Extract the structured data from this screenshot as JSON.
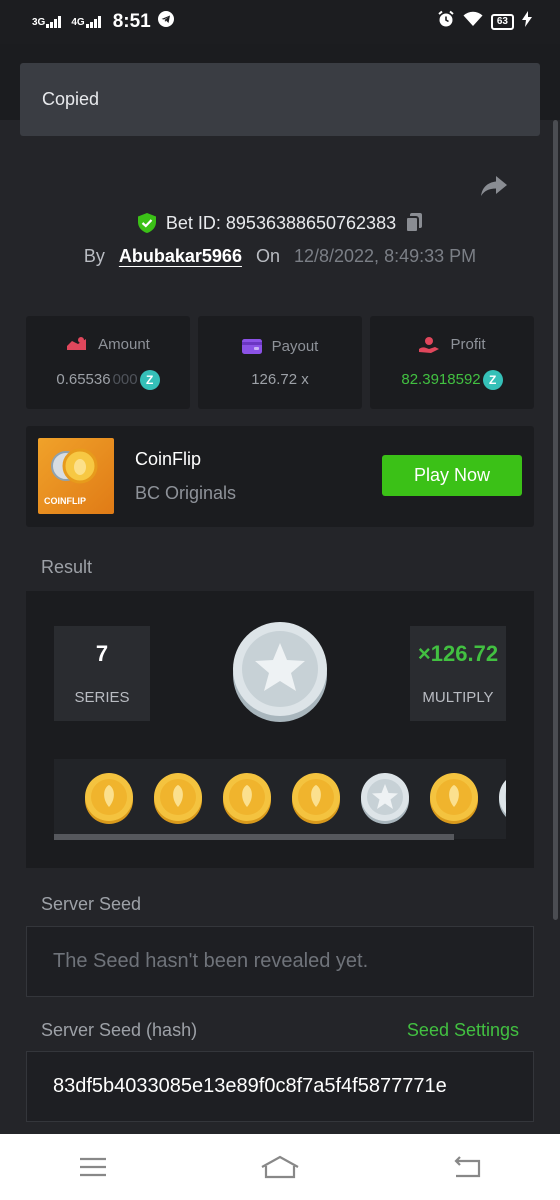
{
  "status_bar": {
    "net1": "3G",
    "net2": "4G",
    "time": "8:51",
    "battery": "63"
  },
  "toast": {
    "text": "Copied"
  },
  "bet": {
    "id_label": "Bet ID: 89536388650762383",
    "by_label": "By",
    "username": "Abubakar5966",
    "on_label": "On",
    "date": "12/8/2022, 8:49:33 PM"
  },
  "stats": {
    "amount_label": "Amount",
    "amount_value": "0.65536",
    "amount_trailing_zeros": "000",
    "payout_label": "Payout",
    "payout_value": "126.72 x",
    "profit_label": "Profit",
    "profit_value": "82.3918592"
  },
  "game": {
    "thumb_text": "COINFLIP",
    "name": "CoinFlip",
    "provider": "BC Originals",
    "play_label": "Play Now"
  },
  "result": {
    "section_label": "Result",
    "series_value": "7",
    "series_label": "SERIES",
    "multiply_value": "×126.72",
    "multiply_label": "MULTIPLY",
    "history": [
      "gold",
      "gold",
      "gold",
      "gold",
      "silver",
      "gold",
      "silver"
    ]
  },
  "server_seed": {
    "label": "Server Seed",
    "value": "The Seed hasn't been revealed yet."
  },
  "server_seed_hash": {
    "label": "Server Seed (hash)",
    "settings_label": "Seed Settings",
    "value": "83df5b4033085e13e89f0c8f7a5f4f5877771e"
  },
  "colors": {
    "accent_green": "#42c041",
    "button_green": "#3bc117",
    "panel": "#1b1c1f",
    "background": "#242529"
  }
}
